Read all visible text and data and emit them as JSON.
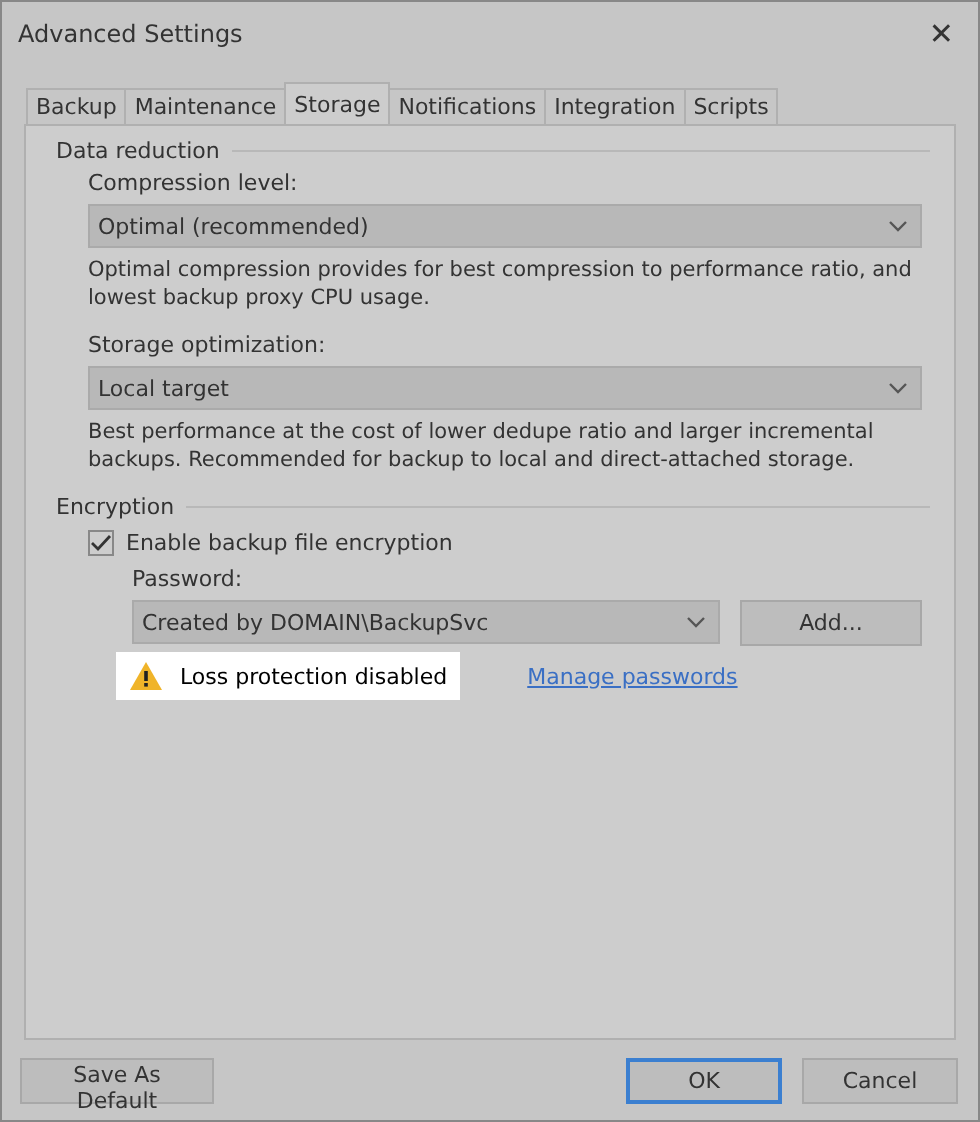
{
  "window": {
    "title": "Advanced Settings",
    "close": "✕"
  },
  "tabs": [
    {
      "label": "Backup",
      "selected": false
    },
    {
      "label": "Maintenance",
      "selected": false
    },
    {
      "label": "Storage",
      "selected": true
    },
    {
      "label": "Notifications",
      "selected": false
    },
    {
      "label": "Integration",
      "selected": false
    },
    {
      "label": "Scripts",
      "selected": false
    }
  ],
  "data_reduction": {
    "heading": "Data reduction",
    "compression": {
      "label": "Compression level:",
      "value": "Optimal (recommended)",
      "description": "Optimal compression provides for best compression to performance ratio, and lowest backup proxy CPU usage."
    },
    "storage_optimization": {
      "label": "Storage optimization:",
      "value": "Local target",
      "description": "Best performance at the cost of lower dedupe ratio and larger incremental backups. Recommended for backup to local and direct-attached storage."
    }
  },
  "encryption": {
    "heading": "Encryption",
    "checkbox": {
      "label": "Enable backup file encryption",
      "checked": true
    },
    "password": {
      "label": "Password:",
      "value": "Created by DOMAIN\\BackupSvc",
      "add_button": "Add..."
    },
    "warning": "Loss protection disabled",
    "link": "Manage passwords"
  },
  "buttons": {
    "save_default": "Save As Default",
    "ok": "OK",
    "cancel": "Cancel"
  }
}
